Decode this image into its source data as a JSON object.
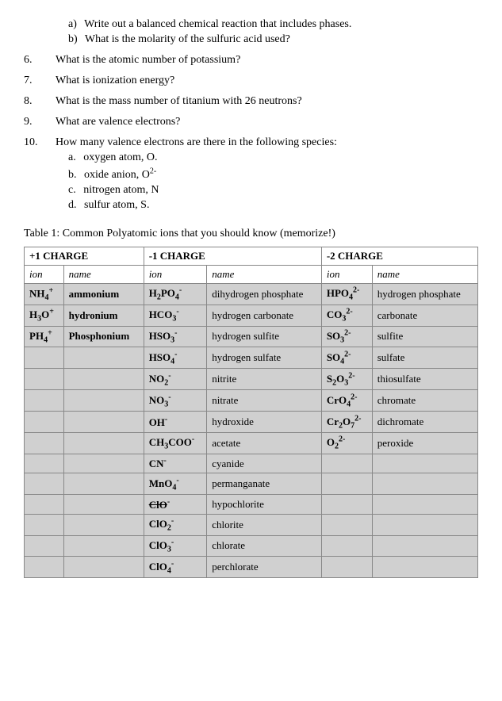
{
  "questions": [
    {
      "num": "",
      "sub_items": [
        {
          "label": "a)",
          "text": "Write out a balanced chemical reaction that includes phases."
        },
        {
          "label": "b)",
          "text": "What is the molarity of the sulfuric acid used?"
        }
      ]
    },
    {
      "num": "6.",
      "text": "What is the atomic number of potassium?"
    },
    {
      "num": "7.",
      "text": "What is ionization energy?"
    },
    {
      "num": "8.",
      "text": "What is the mass number of titanium with 26 neutrons?"
    },
    {
      "num": "9.",
      "text": "What are valence electrons?"
    },
    {
      "num": "10.",
      "text": "How many valence electrons are there in the following species:",
      "sub_items": [
        {
          "label": "a.",
          "text": "oxygen atom, O."
        },
        {
          "label": "b.",
          "text": "oxide anion, O"
        },
        {
          "label": "c.",
          "text": "nitrogen atom, N"
        },
        {
          "label": "d.",
          "text": "sulfur atom, S."
        }
      ]
    }
  ],
  "table_caption": "Table 1: Common Polyatomic ions that you should know (memorize!)",
  "table": {
    "headers": [
      "+1 CHARGE",
      "-1 CHARGE",
      "-2 CHARGE"
    ],
    "col_headers": [
      "ion",
      "name",
      "ion",
      "name",
      "ion",
      "name"
    ],
    "rows": [
      {
        "c1_ion": "NH₄⁺",
        "c1_name": "ammonium",
        "c2_ion": "H₂PO₄⁻",
        "c2_name": "dihydrogen phosphate",
        "c3_ion": "HPO₄²⁻",
        "c3_name": "hydrogen phosphate"
      },
      {
        "c1_ion": "H₃O⁺",
        "c1_name": "hydronium",
        "c2_ion": "HCO₃⁻",
        "c2_name": "hydrogen carbonate",
        "c3_ion": "CO₃²⁻",
        "c3_name": "carbonate"
      },
      {
        "c1_ion": "PH₄⁺",
        "c1_name": "Phosphonium",
        "c2_ion": "HSO₃⁻",
        "c2_name": "hydrogen sulfite",
        "c3_ion": "SO₃²⁻",
        "c3_name": "sulfite"
      },
      {
        "c1_ion": "",
        "c1_name": "",
        "c2_ion": "HSO₄⁻",
        "c2_name": "hydrogen sulfate",
        "c3_ion": "SO₄²⁻",
        "c3_name": "sulfate"
      },
      {
        "c1_ion": "",
        "c1_name": "",
        "c2_ion": "NO₂⁻",
        "c2_name": "nitrite",
        "c3_ion": "S₂O₃²⁻",
        "c3_name": "thiosulfate"
      },
      {
        "c1_ion": "",
        "c1_name": "",
        "c2_ion": "NO₃⁻",
        "c2_name": "nitrate",
        "c3_ion": "CrO₄²⁻",
        "c3_name": "chromate"
      },
      {
        "c1_ion": "",
        "c1_name": "",
        "c2_ion": "OH⁻",
        "c2_name": "hydroxide",
        "c3_ion": "Cr₂O₇²⁻",
        "c3_name": "dichromate"
      },
      {
        "c1_ion": "",
        "c1_name": "",
        "c2_ion": "CH₃COO⁻",
        "c2_name": "acetate",
        "c3_ion": "O₂²⁻",
        "c3_name": "peroxide"
      },
      {
        "c1_ion": "",
        "c1_name": "",
        "c2_ion": "CN⁻",
        "c2_name": "cyanide",
        "c3_ion": "",
        "c3_name": ""
      },
      {
        "c1_ion": "",
        "c1_name": "",
        "c2_ion": "MnO₄⁻",
        "c2_name": "permanganate",
        "c3_ion": "",
        "c3_name": ""
      },
      {
        "c1_ion": "",
        "c1_name": "",
        "c2_ion": "ClO⁻",
        "c2_name": "hypochlorite",
        "c3_ion": "",
        "c3_name": "",
        "c2_ion_strike": true
      },
      {
        "c1_ion": "",
        "c1_name": "",
        "c2_ion": "ClO₂⁻",
        "c2_name": "chlorite",
        "c3_ion": "",
        "c3_name": ""
      },
      {
        "c1_ion": "",
        "c1_name": "",
        "c2_ion": "ClO₃⁻",
        "c2_name": "chlorate",
        "c3_ion": "",
        "c3_name": ""
      },
      {
        "c1_ion": "",
        "c1_name": "",
        "c2_ion": "ClO₄⁻",
        "c2_name": "perchlorate",
        "c3_ion": "",
        "c3_name": ""
      }
    ]
  }
}
